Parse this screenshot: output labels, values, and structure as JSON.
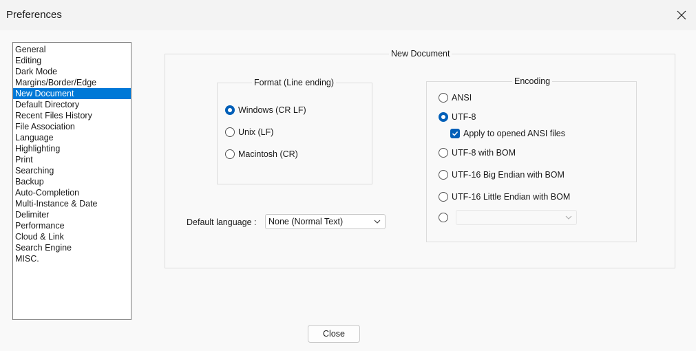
{
  "window": {
    "title": "Preferences"
  },
  "categories": [
    {
      "label": "General",
      "selected": false
    },
    {
      "label": "Editing",
      "selected": false
    },
    {
      "label": "Dark Mode",
      "selected": false
    },
    {
      "label": "Margins/Border/Edge",
      "selected": false
    },
    {
      "label": "New Document",
      "selected": true
    },
    {
      "label": "Default Directory",
      "selected": false
    },
    {
      "label": "Recent Files History",
      "selected": false
    },
    {
      "label": "File Association",
      "selected": false
    },
    {
      "label": "Language",
      "selected": false
    },
    {
      "label": "Highlighting",
      "selected": false
    },
    {
      "label": "Print",
      "selected": false
    },
    {
      "label": "Searching",
      "selected": false
    },
    {
      "label": "Backup",
      "selected": false
    },
    {
      "label": "Auto-Completion",
      "selected": false
    },
    {
      "label": "Multi-Instance & Date",
      "selected": false
    },
    {
      "label": "Delimiter",
      "selected": false
    },
    {
      "label": "Performance",
      "selected": false
    },
    {
      "label": "Cloud & Link",
      "selected": false
    },
    {
      "label": "Search Engine",
      "selected": false
    },
    {
      "label": "MISC.",
      "selected": false
    }
  ],
  "new_document": {
    "title": "New Document",
    "format": {
      "title": "Format (Line ending)",
      "options": [
        {
          "label": "Windows (CR LF)",
          "checked": true
        },
        {
          "label": "Unix (LF)",
          "checked": false
        },
        {
          "label": "Macintosh (CR)",
          "checked": false
        }
      ]
    },
    "encoding": {
      "title": "Encoding",
      "ansi": {
        "label": "ANSI",
        "checked": false
      },
      "utf8": {
        "label": "UTF-8",
        "checked": true
      },
      "apply_ansi": {
        "label": "Apply to opened ANSI files",
        "checked": true
      },
      "utf8_bom": {
        "label": "UTF-8 with BOM",
        "checked": false
      },
      "utf16_be": {
        "label": "UTF-16 Big Endian with BOM",
        "checked": false
      },
      "utf16_le": {
        "label": "UTF-16 Little Endian with BOM",
        "checked": false
      },
      "other": {
        "checked": false,
        "value": ""
      }
    },
    "default_language": {
      "label": "Default language :",
      "value": "None (Normal Text)"
    }
  },
  "buttons": {
    "close": "Close"
  },
  "colors": {
    "accent": "#005fb8",
    "selection": "#0078d7"
  }
}
